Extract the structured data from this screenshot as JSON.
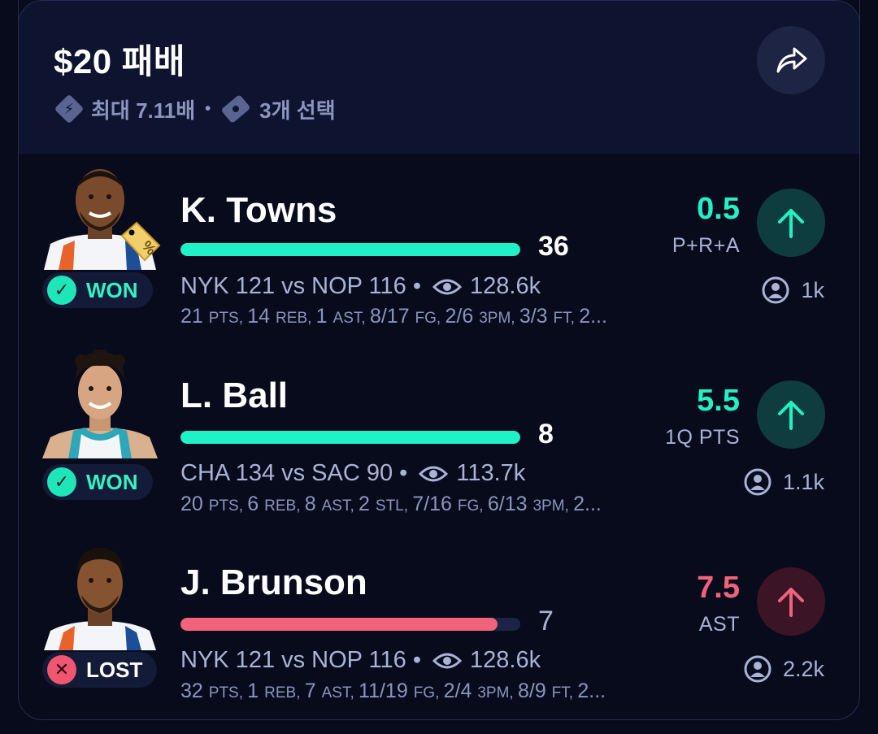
{
  "header": {
    "title": "$20 패배",
    "multiplier": "최대 7.11배",
    "separator": "•",
    "picks": "3개 선택"
  },
  "colors": {
    "green": "#1ff2c4",
    "red": "#f0637a",
    "bg": "#070b1c",
    "header_bg": "#0e1430"
  },
  "legs": [
    {
      "player": "K. Towns",
      "result": "WON",
      "stat_value": "36",
      "progress": 1.0,
      "bar_color": "#1ff2c4",
      "game": "NYK 121 vs NOP 116 •",
      "views": "128.6k",
      "box": [
        [
          "21",
          "PTS, "
        ],
        [
          "14",
          "REB, "
        ],
        [
          "1",
          "AST, "
        ],
        [
          "8/17",
          "FG, "
        ],
        [
          "2/6",
          "3PM, "
        ],
        [
          "3/3",
          "FT, "
        ],
        [
          "2...",
          ""
        ]
      ],
      "line": "0.5",
      "line_color": "#1ff2c4",
      "category": "P+R+A",
      "direction_icon": "arrow-up-icon",
      "users": "1k"
    },
    {
      "player": "L. Ball",
      "result": "WON",
      "stat_value": "8",
      "progress": 1.0,
      "bar_color": "#1ff2c4",
      "game": "CHA 134 vs SAC 90 •",
      "views": "113.7k",
      "box": [
        [
          "20",
          "PTS, "
        ],
        [
          "6",
          "REB, "
        ],
        [
          "8",
          "AST, "
        ],
        [
          "2",
          "STL, "
        ],
        [
          "7/16",
          "FG, "
        ],
        [
          "6/13",
          "3PM, "
        ],
        [
          "2...",
          ""
        ]
      ],
      "line": "5.5",
      "line_color": "#1ff2c4",
      "category": "1Q PTS",
      "direction_icon": "arrow-up-icon",
      "users": "1.1k"
    },
    {
      "player": "J. Brunson",
      "result": "LOST",
      "stat_value": "7",
      "progress": 0.934,
      "bar_color": "#f0637a",
      "game": "NYK 121 vs NOP 116 •",
      "views": "128.6k",
      "box": [
        [
          "32",
          "PTS, "
        ],
        [
          "1",
          "REB, "
        ],
        [
          "7",
          "AST, "
        ],
        [
          "11/19",
          "FG, "
        ],
        [
          "2/4",
          "3PM, "
        ],
        [
          "8/9",
          "FT, "
        ],
        [
          "2...",
          ""
        ]
      ],
      "line": "7.5",
      "line_color": "#f0637a",
      "category": "AST",
      "direction_icon": "arrow-up-icon",
      "users": "2.2k"
    }
  ]
}
